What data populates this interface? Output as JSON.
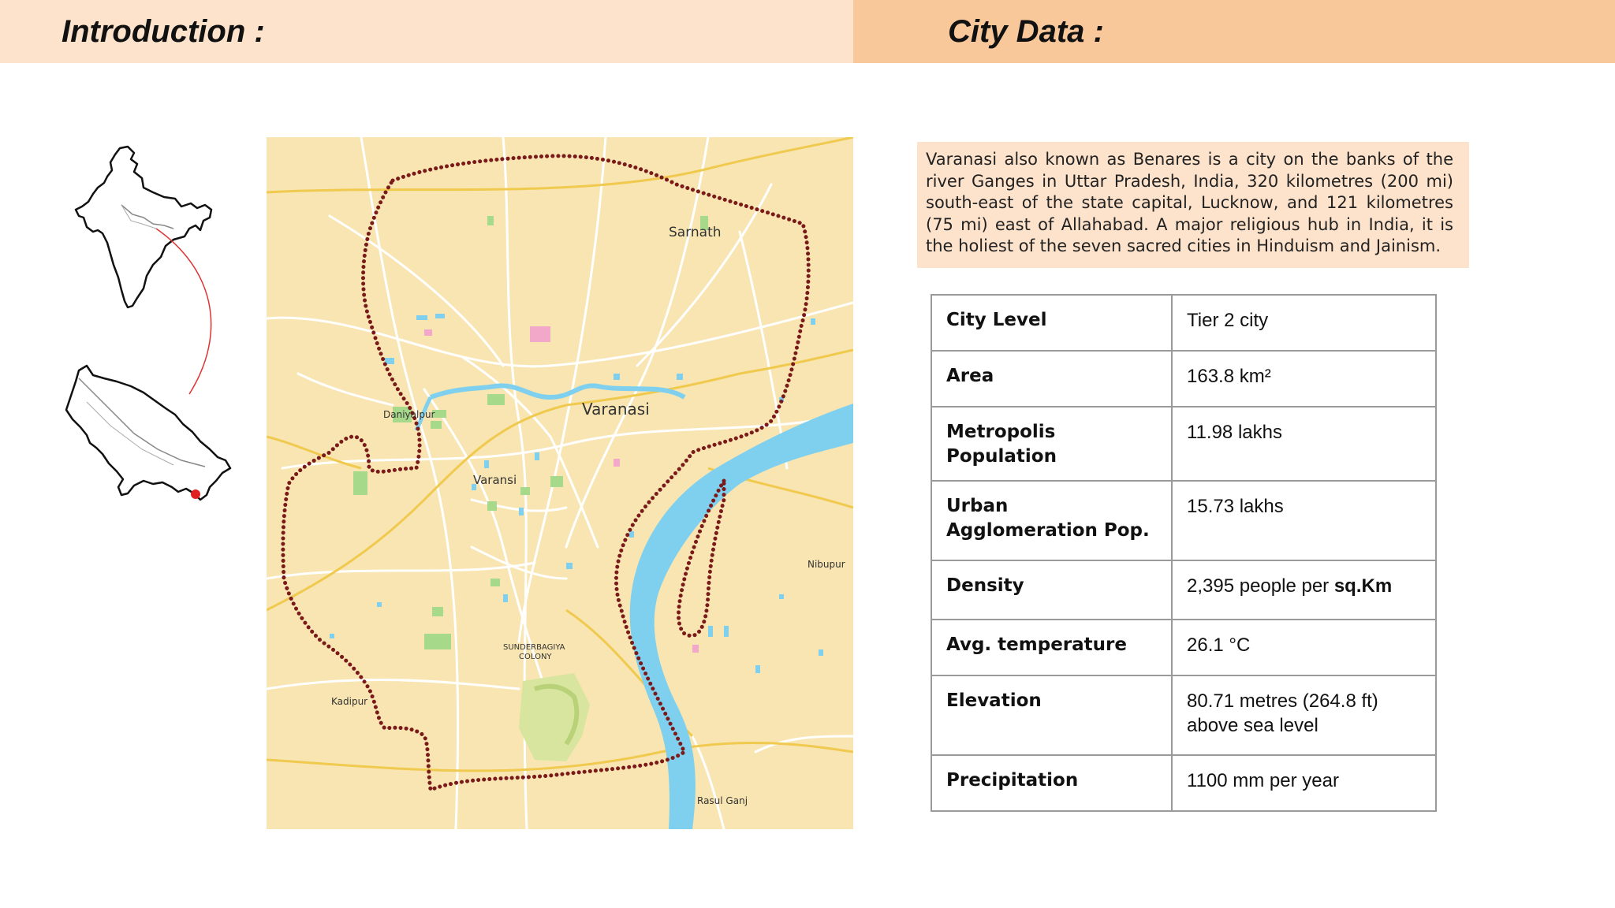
{
  "header": {
    "left_title": "Introduction :",
    "right_title": "City Data :"
  },
  "map": {
    "labels": {
      "sarnath": "Sarnath",
      "varanasi_main": "Varanasi",
      "varanasi_small": "Varansi",
      "daniyalpur": "Daniyalpur",
      "nibupur": "Nibupur",
      "sunderbagiya": "SUNDERBAGIYA",
      "colony": "COLONY",
      "kadipur": "Kadipur",
      "rasul_ganj": "Rasul Ganj"
    },
    "colors": {
      "land": "#f8e5b1",
      "river": "#7fd0ee",
      "boundary": "#7a1a1a",
      "roads": "#ffffff",
      "highways": "#f0c94f"
    }
  },
  "intro_text": "Varanasi also known as Benares is a city on the banks of the river Ganges in Uttar Pradesh, India, 320 kilometres (200 mi) south-east of the state capital, Lucknow, and 121 kilometres (75 mi) east of Allahabad. A major religious hub in India, it is the holiest of the seven sacred cities in Hinduism and Jainism.",
  "city_table": [
    {
      "label": "City Level",
      "value": "Tier 2 city"
    },
    {
      "label": "Area",
      "value": "163.8 km²"
    },
    {
      "label": "Metropolis Population",
      "value": "11.98 lakhs"
    },
    {
      "label": "Urban Agglomeration Pop.",
      "value": "15.73 lakhs"
    },
    {
      "label": "Density",
      "value": "2,395 people per ",
      "value_bold": "sq.Km"
    },
    {
      "label": "Avg. temperature",
      "value": "26.1 °C"
    },
    {
      "label": "Elevation",
      "value": "80.71 metres (264.8 ft)",
      "value_line2": "above sea level"
    },
    {
      "label": "Precipitation",
      "value": "1100 mm per year"
    }
  ]
}
